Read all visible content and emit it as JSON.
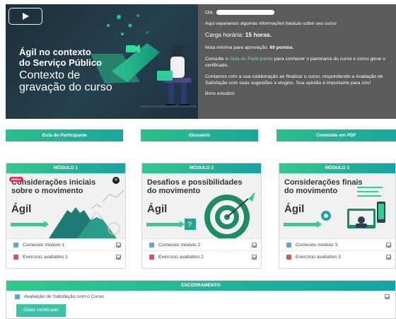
{
  "hero": {
    "banner_title": [
      "Ágil no contexto",
      "do Serviço Público"
    ],
    "banner_subtitle": [
      "Contexto de",
      "gravação do curso"
    ],
    "greeting": "Olá,",
    "intro": "Aqui separamos algumas informações básicas sobre seu curso:",
    "workload_label": "Carga horária: ",
    "workload_value": "15 horas.",
    "min_grade_label": "Nota mínima para aprovação: ",
    "min_grade_value": "60 pontos.",
    "consult_pre": "Consulte o ",
    "consult_link": "Guia do Participante",
    "consult_post": " para conhecer o panorama do curso e como gerar o certificado.",
    "collab": "Contamos com a sua colaboração ao finalizar o curso, respondendo a Avaliação de Satisfação com suas sugestões e elogios. Sua opinião é importante para nós!",
    "farewell": "Bons estudos!"
  },
  "resources": [
    "Guia do Participante",
    "Glossário",
    "Conteúdo em PDF"
  ],
  "modules": [
    {
      "header": "MÓDULO 1",
      "title": [
        "Considerações iniciais",
        "sobre o movimento"
      ],
      "agil": "Ágil",
      "save_badge": "Salvar",
      "rows": [
        "Conteúdo módulo 1",
        "Exercício avaliativo 1"
      ]
    },
    {
      "header": "MÓDULO 2",
      "title": [
        "Desafios e possibilidades",
        "do movimento"
      ],
      "agil": "Ágil",
      "rows": [
        "Conteúdo módulo 2",
        "Exercício avaliativo 2"
      ]
    },
    {
      "header": "MÓDULO 3",
      "title": [
        "Considerações finais",
        "do movimento"
      ],
      "agil": "Ágil",
      "rows": [
        "Conteúdo módulo 3",
        "Exercício avaliativo 3"
      ]
    }
  ],
  "closing": {
    "header": "ENCERRAMENTO",
    "survey": "Avaliação de Satisfação com o Curso",
    "certificate_button": "Obter certificado"
  },
  "colors": {
    "accent_green": "#2bbf8a",
    "accent_teal": "#16a2a2",
    "info_panel": "#5b5b5b",
    "link_green": "#7ce3a0",
    "save_pink": "#e0245e"
  },
  "icons": [
    "play-icon",
    "close-circle-icon",
    "content-page-icon",
    "exercise-pencil-icon",
    "checkbox-icon",
    "survey-icon"
  ]
}
